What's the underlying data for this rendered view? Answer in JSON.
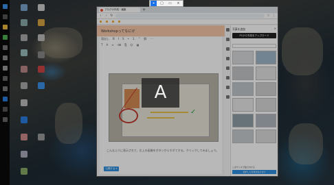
{
  "capture_toolbar": {
    "buttons": [
      {
        "icon": "select-region-icon",
        "glyph": "⌖"
      },
      {
        "icon": "window-capture-icon",
        "glyph": "▢"
      },
      {
        "icon": "fullscreen-capture-icon",
        "glyph": "▭"
      },
      {
        "icon": "close-icon",
        "glyph": "×"
      }
    ]
  },
  "browser": {
    "tab_title": "ブログの作成・編集",
    "url": "",
    "editor": {
      "post_title": "Workshopってなにげ",
      "toolbar_row1": [
        "見出し",
        "B",
        "I",
        "S",
        "•",
        "1.",
        "“",
        "⛓",
        "⋯"
      ],
      "toolbar_row2": [
        "T",
        "A",
        "≡",
        "⌫",
        "⎘",
        "☺",
        "▦"
      ],
      "body_text": "こんなふうに表示されて、左上の画像をボタンからすぎてする。クリックしてみましょう。",
      "publish_label": "公開する ▾"
    },
    "panel": {
      "title": "写真を追加",
      "close_glyph": "×",
      "upload_label": "PCから写真をアップロード",
      "select_value": "",
      "footer_check": "このサイズで貼り付ける",
      "footer_button": "選択した写真を貼り付け"
    }
  },
  "overlay": {
    "glyph": "A"
  },
  "colors": {
    "accent_blue": "#2f8fe0",
    "editor_header": "#f6c7a8",
    "capture_active": "#1a73e8"
  }
}
